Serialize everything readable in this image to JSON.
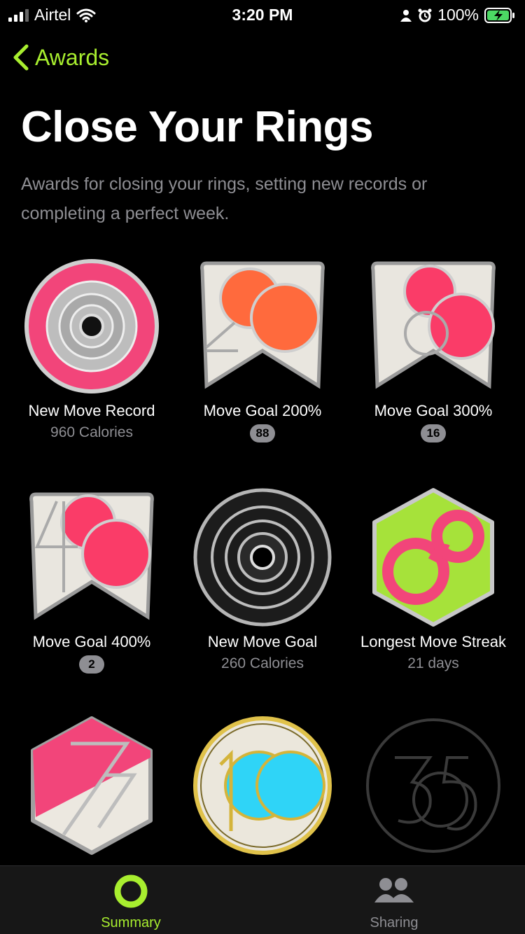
{
  "status_bar": {
    "carrier": "Airtel",
    "time": "3:20 PM",
    "battery": "100%"
  },
  "nav": {
    "back_label": "Awards"
  },
  "page": {
    "title": "Close Your Rings",
    "description": "Awards for closing your rings, setting new records or completing a perfect week."
  },
  "awards": [
    {
      "name": "New Move Record",
      "detail": "960 Calories",
      "count": ""
    },
    {
      "name": "Move Goal 200%",
      "detail": "",
      "count": "88"
    },
    {
      "name": "Move Goal 300%",
      "detail": "",
      "count": "16"
    },
    {
      "name": "Move Goal 400%",
      "detail": "",
      "count": "2"
    },
    {
      "name": "New Move Goal",
      "detail": "260 Calories",
      "count": ""
    },
    {
      "name": "Longest Move Streak",
      "detail": "21 days",
      "count": ""
    }
  ],
  "tabs": [
    {
      "label": "Summary",
      "active": true
    },
    {
      "label": "Sharing",
      "active": false
    }
  ],
  "colors": {
    "accent": "#a8ee2f",
    "move_red": "#fa3c68",
    "orange": "#ff6a3d",
    "cyan": "#2fd4f7"
  }
}
